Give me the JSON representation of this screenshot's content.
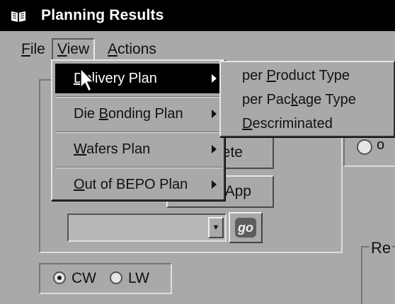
{
  "window": {
    "title": "Planning Results",
    "icon": "book-icon"
  },
  "menubar": {
    "items": [
      {
        "label": "File",
        "underline": "F"
      },
      {
        "label": "View",
        "underline": "V"
      },
      {
        "label": "Actions",
        "underline": "A"
      }
    ]
  },
  "view_menu": {
    "items": [
      {
        "label": "Delivery Plan"
      },
      {
        "label": "Die Bonding Plan"
      },
      {
        "label": "Wafers Plan"
      },
      {
        "label": "Out of BEPO Plan"
      }
    ]
  },
  "delivery_submenu": {
    "items": [
      {
        "label": "per Product Type"
      },
      {
        "label": "per Package Type"
      },
      {
        "label": "Descriminated"
      }
    ]
  },
  "background": {
    "button1_partial": "ete",
    "button2_partial": "App",
    "go_label": "go",
    "right_group_partial": "Re",
    "radio_cw": "CW",
    "radio_lw": "LW",
    "radio_selected": "CW"
  }
}
